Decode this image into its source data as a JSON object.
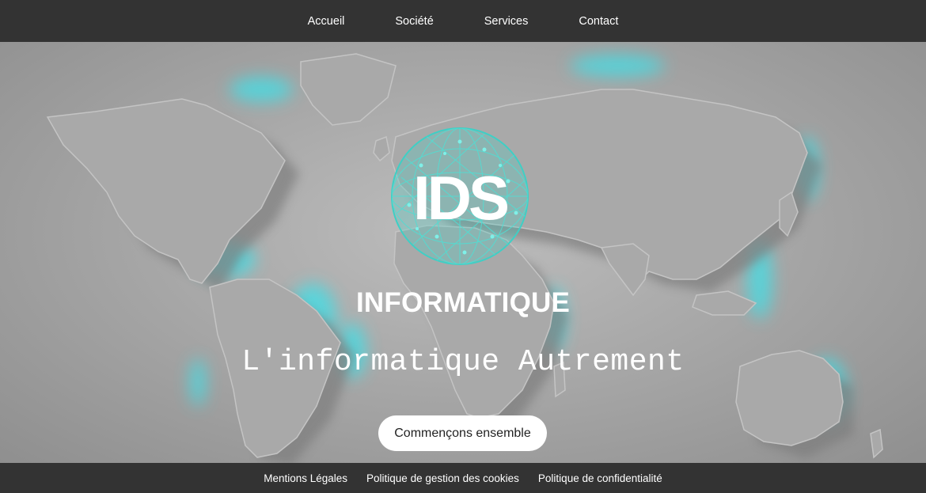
{
  "nav": {
    "items": [
      {
        "label": "Accueil"
      },
      {
        "label": "Société"
      },
      {
        "label": "Services"
      },
      {
        "label": "Contact"
      }
    ]
  },
  "hero": {
    "logo_text": "IDS",
    "title": "INFORMATIQUE",
    "tagline": "L'informatique Autrement",
    "cta_label": "Commençons ensemble"
  },
  "footer": {
    "links": [
      {
        "label": "Mentions Légales"
      },
      {
        "label": "Politique de gestion des cookies"
      },
      {
        "label": "Politique de confidentialité"
      }
    ]
  },
  "colors": {
    "bar_bg": "#333333",
    "glow": "#3fe0e8",
    "logo_teal": "#3fcfc5",
    "land": "#a9a9a9"
  },
  "icons": {
    "logo": "globe-network-logo"
  }
}
